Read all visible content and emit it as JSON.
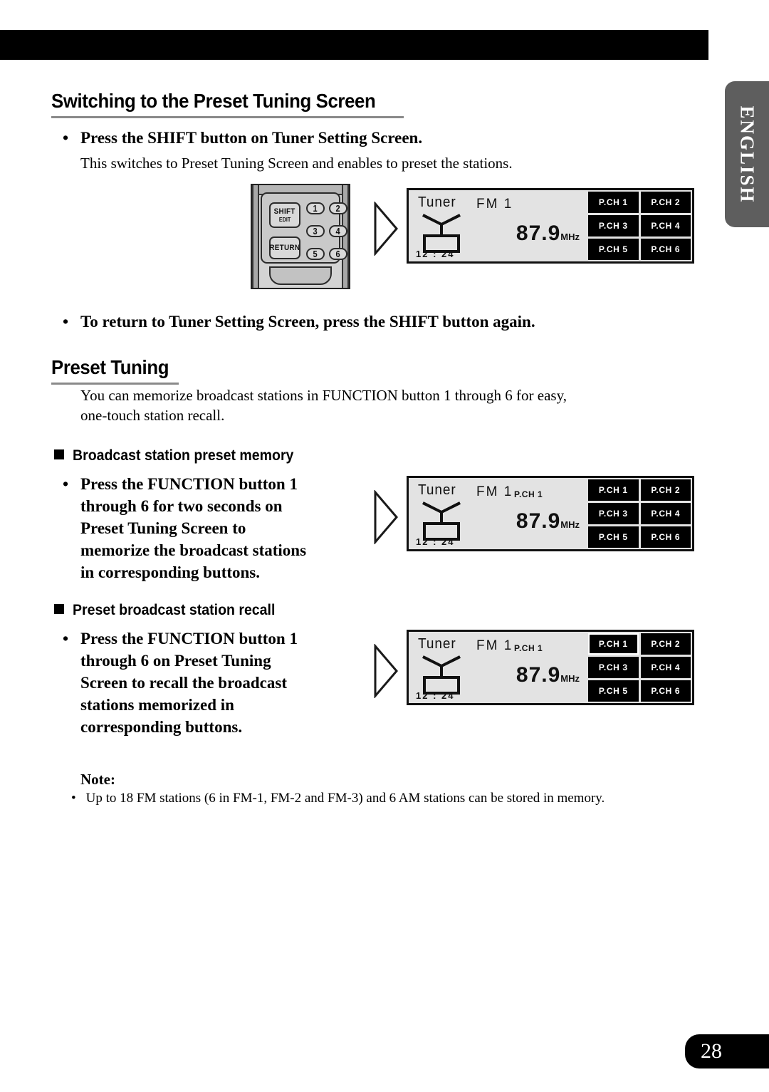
{
  "page": {
    "number": "28",
    "language_tab": "ENGLISH"
  },
  "sections": {
    "switching": {
      "heading": "Switching to the Preset Tuning Screen",
      "bullet": "Press the SHIFT button on Tuner Setting Screen.",
      "description": "This switches to Preset Tuning Screen and enables to preset the stations.",
      "return_bullet": "To return to Tuner Setting Screen, press the SHIFT button again."
    },
    "preset_tuning": {
      "heading": "Preset Tuning",
      "description_line1": "You can memorize broadcast stations in FUNCTION button 1 through 6 for easy,",
      "description_line2": "one-touch station recall."
    },
    "preset_memory": {
      "heading": "Broadcast station preset memory",
      "bullet_line1": "Press the FUNCTION button 1",
      "bullet_line2": "through 6 for two seconds on",
      "bullet_line3": "Preset Tuning Screen to",
      "bullet_line4": "memorize the broadcast stations",
      "bullet_line5": "in corresponding buttons."
    },
    "preset_recall": {
      "heading": "Preset broadcast station recall",
      "bullet_line1": "Press the FUNCTION button 1",
      "bullet_line2": "through 6 on Preset Tuning",
      "bullet_line3": "Screen to recall the broadcast",
      "bullet_line4": "stations memorized in",
      "bullet_line5": "corresponding buttons."
    },
    "note": {
      "title": "Note:",
      "bullet": "Up to 18 FM stations (6 in FM-1, FM-2 and FM-3) and 6 AM stations can be stored in memory."
    }
  },
  "remote": {
    "shift_label": "SHIFT",
    "shift_sub_label": "EDIT",
    "return_label": "RETURN",
    "num_1": "1",
    "num_2": "2",
    "num_3": "3",
    "num_4": "4",
    "num_5": "5",
    "num_6": "6"
  },
  "displays": {
    "first": {
      "source": "Tuner",
      "band": "FM 1",
      "preset_indicator": "",
      "frequency": "87.9",
      "unit": "MHz",
      "clock": "12 : 24",
      "presets": [
        "P.CH 1",
        "P.CH 2",
        "P.CH 3",
        "P.CH 4",
        "P.CH 5",
        "P.CH 6"
      ],
      "selected_preset": -1
    },
    "second": {
      "source": "Tuner",
      "band": "FM 1",
      "preset_indicator": "P.CH 1",
      "frequency": "87.9",
      "unit": "MHz",
      "clock": "12 : 24",
      "presets": [
        "P.CH 1",
        "P.CH 2",
        "P.CH 3",
        "P.CH 4",
        "P.CH 5",
        "P.CH 6"
      ],
      "selected_preset": -1
    },
    "third": {
      "source": "Tuner",
      "band": "FM 1",
      "preset_indicator": "P.CH 1",
      "frequency": "87.9",
      "unit": "MHz",
      "clock": "12 : 24",
      "presets": [
        "P.CH 1",
        "P.CH 2",
        "P.CH 3",
        "P.CH 4",
        "P.CH 5",
        "P.CH 6"
      ],
      "selected_preset": 0
    }
  },
  "colors": {
    "tab_background": "#5e5e5e",
    "bar_black": "#000000",
    "rule_gray": "#8a8a8a",
    "lcd_background": "#e3e3e3"
  }
}
